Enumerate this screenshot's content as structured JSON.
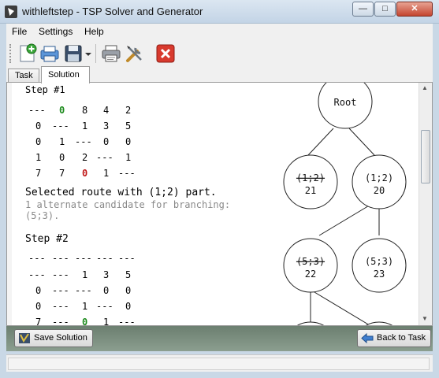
{
  "window": {
    "title": "withleftstep - TSP Solver and Generator",
    "minimize_glyph": "—",
    "maximize_glyph": "□",
    "close_glyph": "✕"
  },
  "menu": {
    "items": [
      {
        "label": "File"
      },
      {
        "label": "Settings"
      },
      {
        "label": "Help"
      }
    ]
  },
  "toolbar": {
    "icons": [
      "new-document-icon",
      "open-printer-icon",
      "save-icon",
      "dropdown-arrow-icon",
      "print-icon",
      "tools-icon",
      "close-red-icon"
    ]
  },
  "tabs": [
    {
      "label": "Task",
      "active": false
    },
    {
      "label": "Solution",
      "active": true
    }
  ],
  "solution": {
    "step1": {
      "heading": "Step #1",
      "rows": [
        [
          "---",
          "0",
          "8",
          "4",
          "2"
        ],
        [
          "0",
          "---",
          "1",
          "3",
          "5"
        ],
        [
          "0",
          "1",
          "---",
          "0",
          "0"
        ],
        [
          "1",
          "0",
          "2",
          "---",
          "1"
        ],
        [
          "7",
          "7",
          "0",
          "1",
          "---"
        ]
      ],
      "selected_text": "Selected route with (1;2) part.",
      "candidate_line1": "1 alternate candidate for branching:",
      "candidate_line2": "(5;3)."
    },
    "step2": {
      "heading": "Step #2",
      "rows": [
        [
          "---",
          "---",
          "---",
          "---",
          "---"
        ],
        [
          "---",
          "---",
          "1",
          "3",
          "5"
        ],
        [
          "0",
          "---",
          "---",
          "0",
          "0"
        ],
        [
          "0",
          "---",
          "1",
          "---",
          "0"
        ],
        [
          "7",
          "---",
          "0",
          "1",
          "---"
        ]
      ]
    },
    "highlight_colors": {
      "green": "#1c8a1c",
      "red": "#c01818"
    }
  },
  "tree": {
    "root_label": "Root",
    "nodes": [
      {
        "label": "(1;2)",
        "value": "21",
        "excluded": true
      },
      {
        "label": "(1;2)",
        "value": "20",
        "excluded": false
      },
      {
        "label": "(5;3)",
        "value": "22",
        "excluded": true
      },
      {
        "label": "(5;3)",
        "value": "23",
        "excluded": false
      }
    ]
  },
  "buttons": {
    "save_solution": "Save Solution",
    "back_to_task": "Back to Task"
  }
}
